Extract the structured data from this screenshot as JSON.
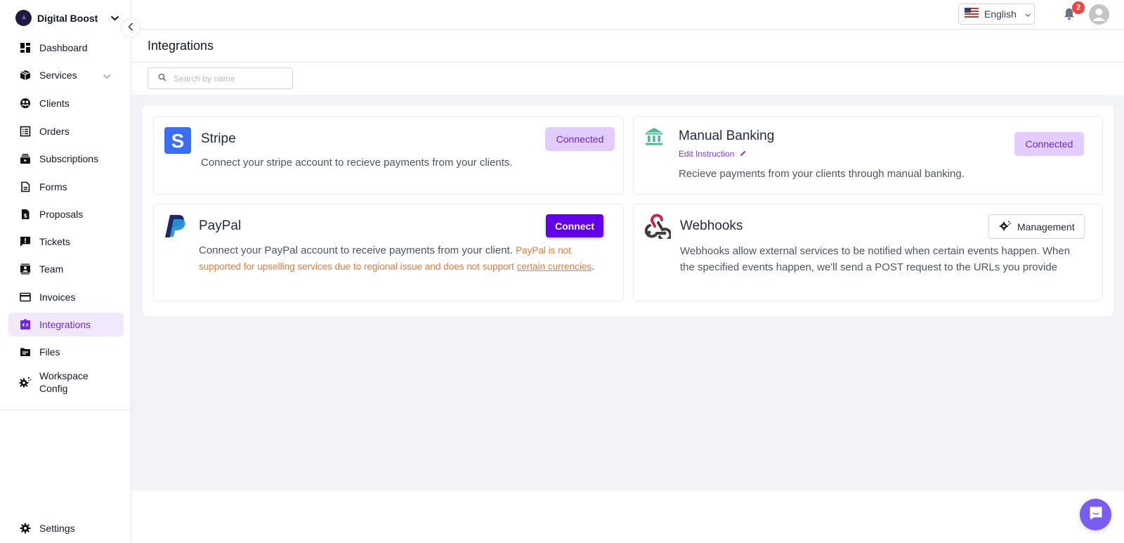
{
  "brand": {
    "name": "Digital Boost"
  },
  "sidebar": {
    "items": [
      {
        "label": "Dashboard",
        "icon": "dashboard-icon"
      },
      {
        "label": "Services",
        "icon": "box-icon",
        "expandable": true
      },
      {
        "label": "Clients",
        "icon": "users-icon"
      },
      {
        "label": "Orders",
        "icon": "list-icon"
      },
      {
        "label": "Subscriptions",
        "icon": "subscriptions-icon"
      },
      {
        "label": "Forms",
        "icon": "document-icon"
      },
      {
        "label": "Proposals",
        "icon": "proposal-icon"
      },
      {
        "label": "Tickets",
        "icon": "ticket-icon"
      },
      {
        "label": "Team",
        "icon": "team-icon"
      },
      {
        "label": "Invoices",
        "icon": "credit-card-icon"
      },
      {
        "label": "Integrations",
        "icon": "integrations-icon",
        "active": true
      },
      {
        "label": "Files",
        "icon": "folder-icon"
      },
      {
        "label": "Workspace Config",
        "icon": "workspace-config-icon"
      }
    ],
    "settings": {
      "label": "Settings",
      "icon": "gear-icon"
    }
  },
  "topbar": {
    "language": "English",
    "notifications_count": "2"
  },
  "page": {
    "title": "Integrations",
    "search_placeholder": "Search by name",
    "search_value": ""
  },
  "integrations": {
    "stripe": {
      "name": "Stripe",
      "description": "Connect your stripe account to recieve payments from your clients.",
      "status_label": "Connected"
    },
    "manual_banking": {
      "name": "Manual Banking",
      "edit_label": "Edit Instruction",
      "description": "Recieve payments from your clients through manual banking.",
      "status_label": "Connected"
    },
    "paypal": {
      "name": "PayPal",
      "description": "Connect your PayPal account to receive payments from your client.",
      "warning": "PayPal is not supported for upselling services due to regional issue and does not support",
      "warning_link": "certain currencies",
      "warning_end": ".",
      "action_label": "Connect"
    },
    "webhooks": {
      "name": "Webhooks",
      "description": "Webhooks allow external services to be notified when certain events happen. When the specified events happen, we'll send a POST request to the URLs you provide",
      "action_label": "Management"
    }
  },
  "colors": {
    "accent": "#6200ea",
    "connected_bg": "#e3ccff",
    "connected_text": "#6d28d9",
    "warning": "#e07b39",
    "bank_icon": "#4fb79a",
    "stripe": "#3b6ef5",
    "chat": "#7b5cf0"
  }
}
